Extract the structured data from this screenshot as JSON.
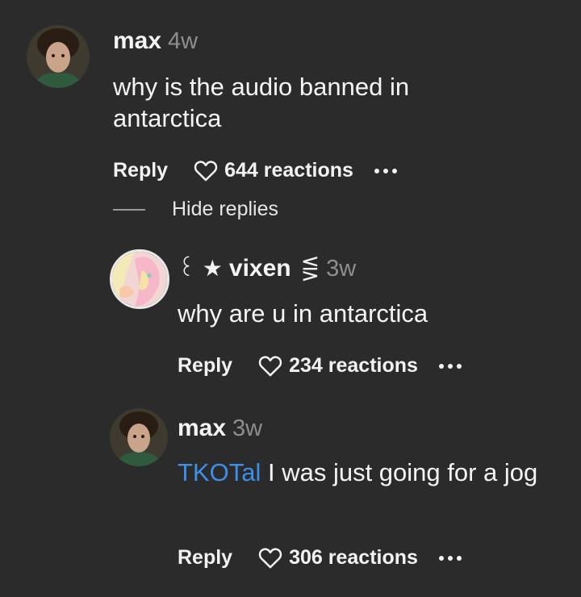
{
  "comments": [
    {
      "username": "max",
      "time": "4w",
      "text": "why is the audio banned in antarctica",
      "reply_label": "Reply",
      "reactions": "644 reactions"
    }
  ],
  "hide_replies_label": "Hide replies",
  "replies": [
    {
      "name_prefix": "꒰ ★",
      "username": "vixen",
      "name_suffix": "⋚",
      "time": "3w",
      "text": "why are u in antarctica",
      "reply_label": "Reply",
      "reactions": "234 reactions"
    },
    {
      "username": "max",
      "time": "3w",
      "mention": "TKOTal",
      "text": " I was just going for a jog",
      "reply_label": "Reply",
      "reactions": "306 reactions"
    }
  ],
  "colors": {
    "background": "#2b2b2b",
    "mention": "#3d8fe8",
    "timestamp": "#8e8e8e"
  }
}
